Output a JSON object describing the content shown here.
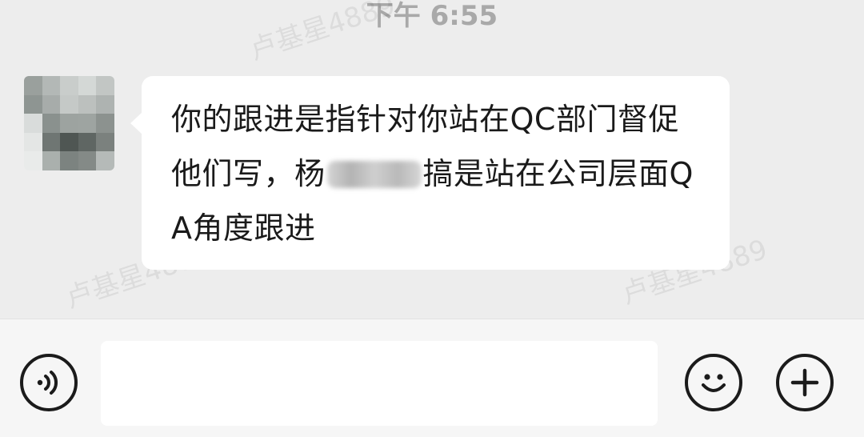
{
  "chat": {
    "timestamp": "下午 6:55",
    "watermark": "卢基星4889",
    "message": {
      "text_part1": "你的跟进是指针对你站在QC部门督促他们写，杨",
      "text_part2": "搞是站在公司层面QA角度跟进"
    }
  },
  "input_bar": {
    "input_value": "",
    "placeholder": "",
    "voice_icon": "voice-icon",
    "emoji_icon": "emoji-icon",
    "plus_icon": "plus-icon"
  },
  "colors": {
    "background": "#ededed",
    "bubble": "#ffffff",
    "input_bar": "#f6f6f6",
    "text": "#1a1a1a",
    "timestamp": "#a9a9a9"
  }
}
